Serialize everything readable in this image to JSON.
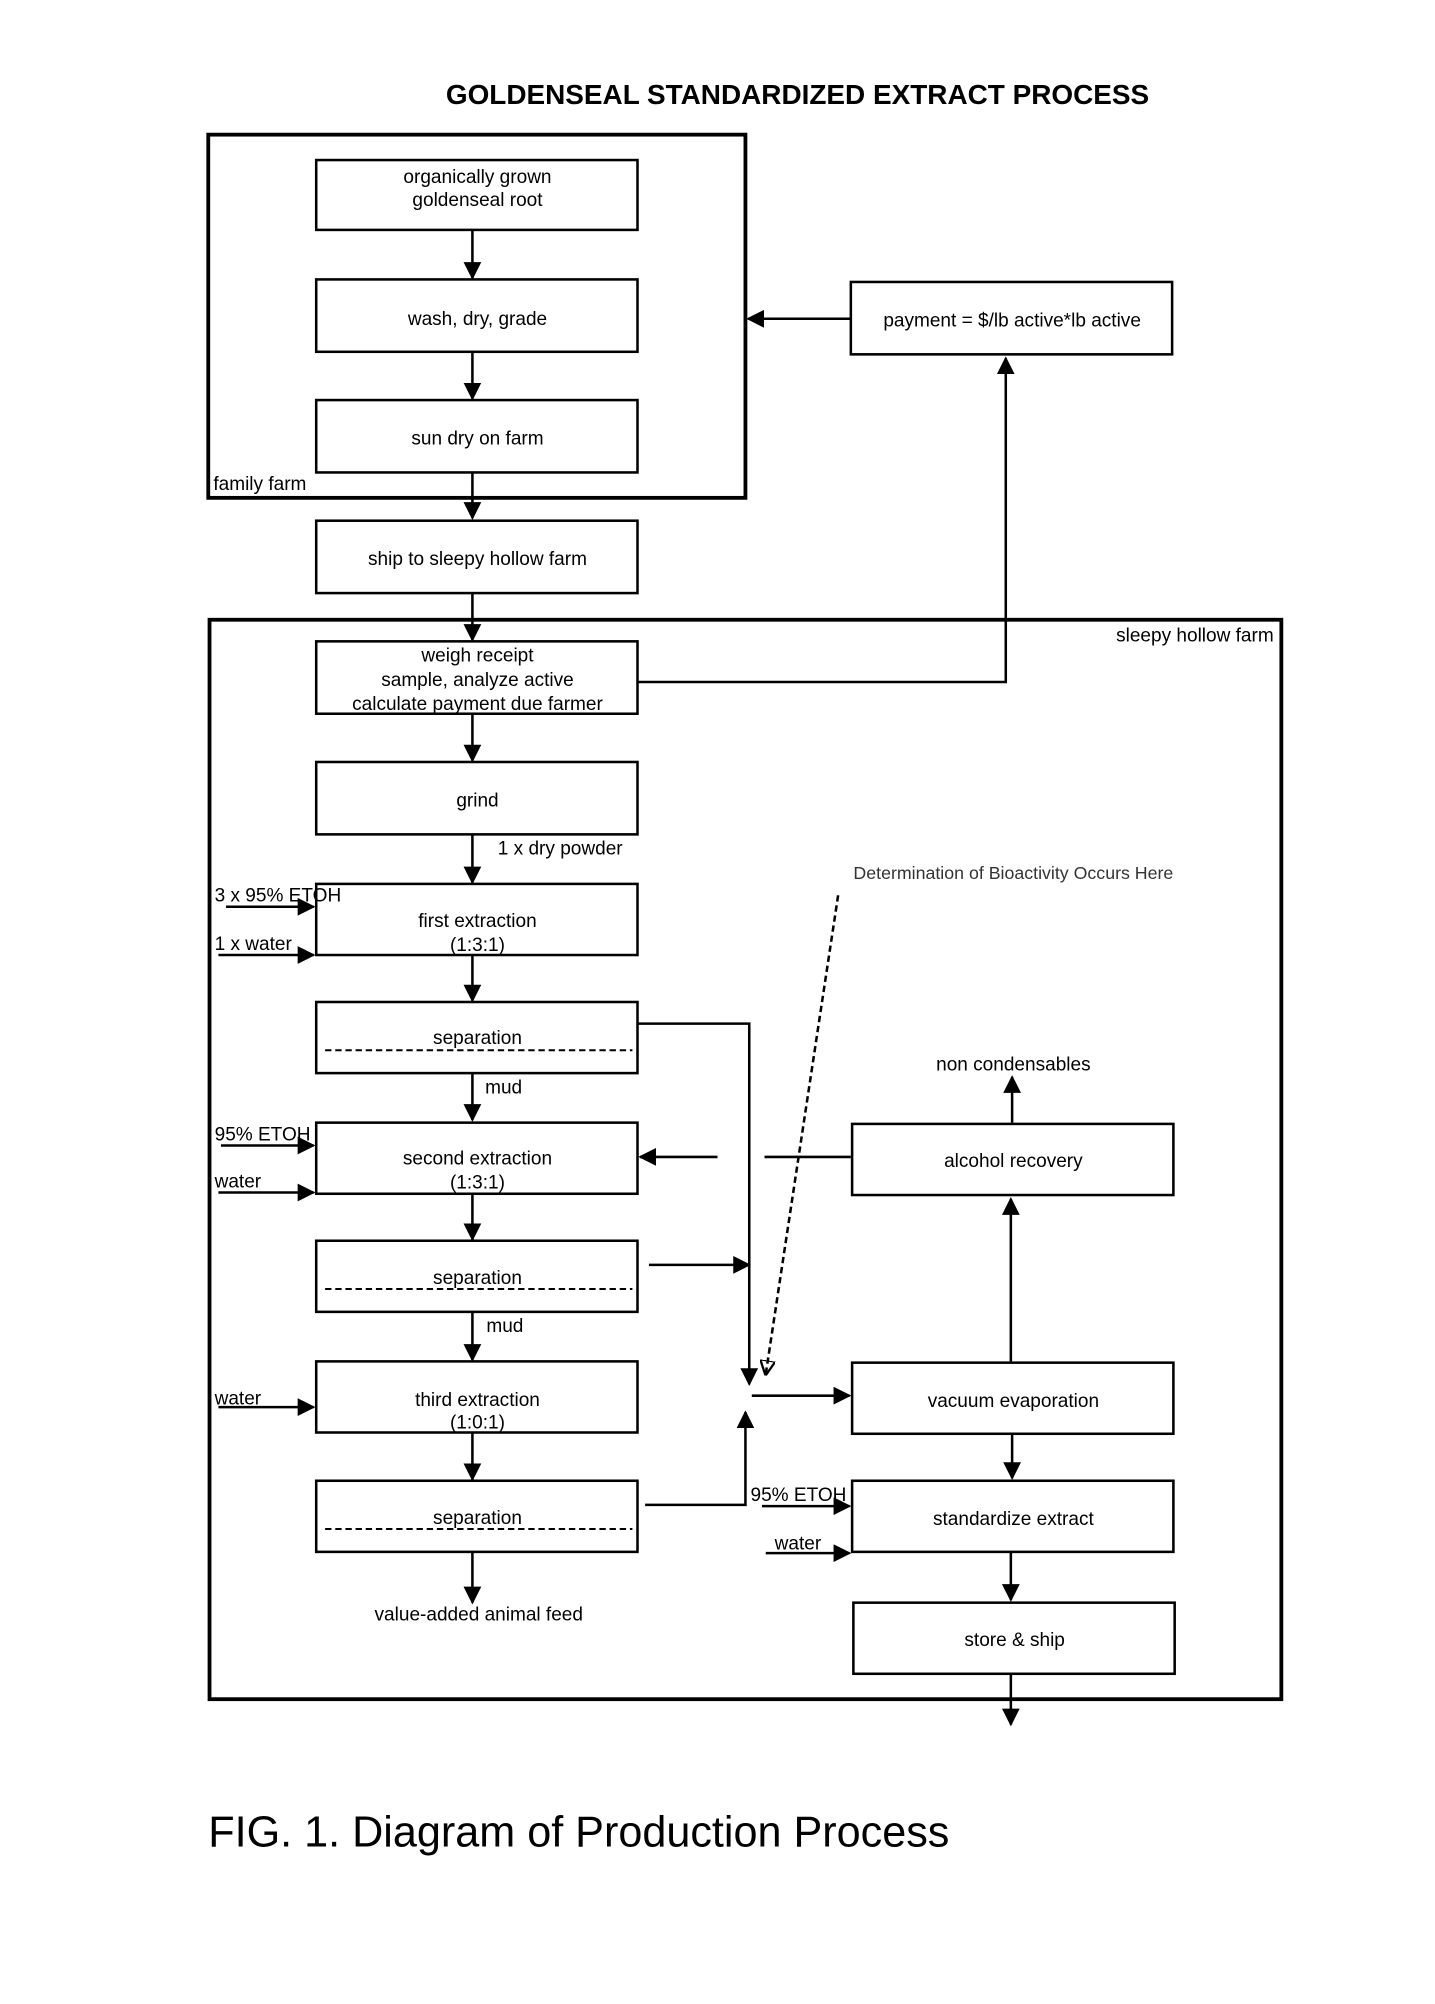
{
  "title": "GOLDENSEAL STANDARDIZED EXTRACT PROCESS",
  "caption": "FIG. 1. Diagram of Production Process",
  "regions": {
    "family_farm": "family farm",
    "sleepy_hollow": "sleepy hollow farm"
  },
  "boxes": {
    "organic_root": [
      "organically grown",
      "goldenseal root"
    ],
    "wash": "wash, dry, grade",
    "sun_dry": "sun dry on farm",
    "ship": "ship to sleepy hollow farm",
    "payment": "payment = $/lb active*lb active",
    "weigh": [
      "weigh receipt",
      "sample, analyze active",
      "calculate payment due farmer"
    ],
    "grind": "grind",
    "first_extraction": [
      "first extraction",
      "(1:3:1)"
    ],
    "separation_1": "separation",
    "second_extraction": [
      "second extraction",
      "(1:3:1)"
    ],
    "separation_2": "separation",
    "third_extraction": [
      "third extraction",
      "(1:0:1)"
    ],
    "separation_3": "separation",
    "alcohol_recovery": "alcohol recovery",
    "vacuum_evaporation": "vacuum evaporation",
    "standardize": "standardize extract",
    "store_ship": "store & ship"
  },
  "labels": {
    "dry_powder": "1 x dry powder",
    "etoh_3x": "3 x 95% ETOH",
    "water_1x": "1 x water",
    "mud_1": "mud",
    "etoh_2": "95% ETOH",
    "water_2": "water",
    "mud_2": "mud",
    "water_3": "water",
    "animal_feed": "value-added animal feed",
    "non_condensables": "non condensables",
    "etoh_std": "95% ETOH",
    "water_std": "water",
    "bioactivity_note": "Determination of Bioactivity Occurs Here"
  }
}
